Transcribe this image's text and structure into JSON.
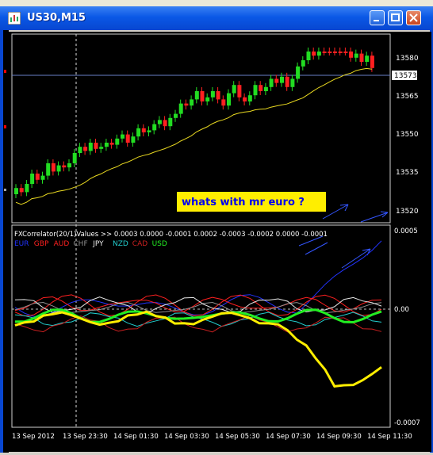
{
  "window": {
    "title": "US30,M15"
  },
  "annotation": {
    "text": "whats with mr euro ?"
  },
  "price_axis": {
    "labels": [
      "13580",
      "13565",
      "13550",
      "13535",
      "13520"
    ],
    "current_price": "13573"
  },
  "indicator": {
    "header": "FXCorrelator(20/1)Values >> 0.0003 0.0000 -0.0001 0.0002 -0.0003 -0.0002 0.0000 -0.0001",
    "legend": [
      {
        "label": "EUR",
        "color": "#2233ff"
      },
      {
        "label": "GBP",
        "color": "#ff2020"
      },
      {
        "label": "AUD",
        "color": "#ff2020"
      },
      {
        "label": "CHF",
        "color": "#8f8f8f"
      },
      {
        "label": "JPY",
        "color": "#e8e8e8"
      },
      {
        "label": "NZD",
        "color": "#22cccc"
      },
      {
        "label": "CAD",
        "color": "#cc2020"
      },
      {
        "label": "USD",
        "color": "#22ee22"
      }
    ],
    "axis_labels": [
      "0.0005",
      "0.00",
      "-0.0007"
    ]
  },
  "time_axis": {
    "labels": [
      "13 Sep 2012",
      "13 Sep 23:30",
      "14 Sep 01:30",
      "14 Sep 03:30",
      "14 Sep 05:30",
      "14 Sep 07:30",
      "14 Sep 09:30",
      "14 Sep 11:30"
    ]
  },
  "colors": {
    "up_candle": "#22dd22",
    "down_candle": "#ff2020",
    "moving_average": "#e8d820",
    "usd_line": "#22ee22",
    "yellow_line": "#ffee00",
    "annotation_bg": "#ffee00",
    "annotation_text": "#0000ee",
    "arrow": "#3355ff"
  }
}
